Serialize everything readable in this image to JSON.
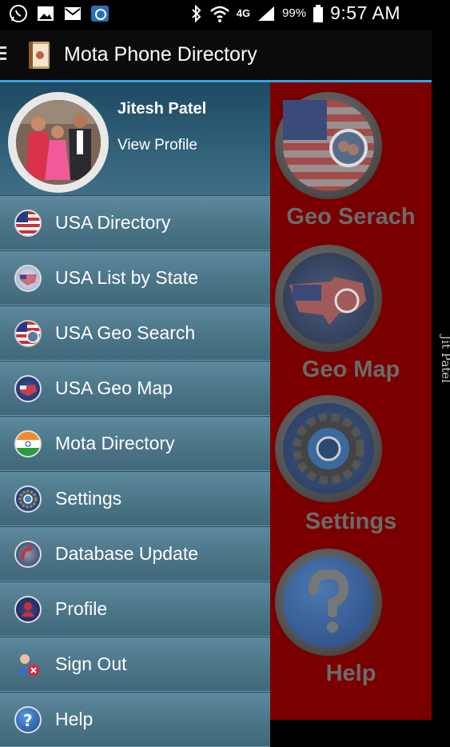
{
  "status_bar": {
    "battery": "99%",
    "time": "9:57 AM",
    "network": "4G"
  },
  "app_bar": {
    "title": "Mota Phone Directory"
  },
  "profile": {
    "name": "Jitesh Patel",
    "view_profile": "View Profile"
  },
  "menu": {
    "items": [
      {
        "label": "USA Directory",
        "icon": "usa-flag-icon"
      },
      {
        "label": "USA List by State",
        "icon": "usa-map-icon"
      },
      {
        "label": "USA Geo Search",
        "icon": "geo-search-icon"
      },
      {
        "label": "USA Geo Map",
        "icon": "geo-map-icon"
      },
      {
        "label": "Mota Directory",
        "icon": "india-flag-icon"
      },
      {
        "label": "Settings",
        "icon": "gear-icon"
      },
      {
        "label": "Database Update",
        "icon": "database-update-icon"
      },
      {
        "label": "Profile",
        "icon": "profile-icon"
      },
      {
        "label": "Sign Out",
        "icon": "sign-out-icon"
      },
      {
        "label": "Help",
        "icon": "help-icon"
      }
    ]
  },
  "background_buttons": {
    "geo_search": "Geo Serach",
    "geo_map": "Geo Map",
    "settings": "Settings",
    "help": "Help"
  },
  "watermark": "Jit Patel",
  "colors": {
    "accent": "#3aa3e0",
    "background_red": "#7a0000",
    "drawer": "#4d7689"
  }
}
